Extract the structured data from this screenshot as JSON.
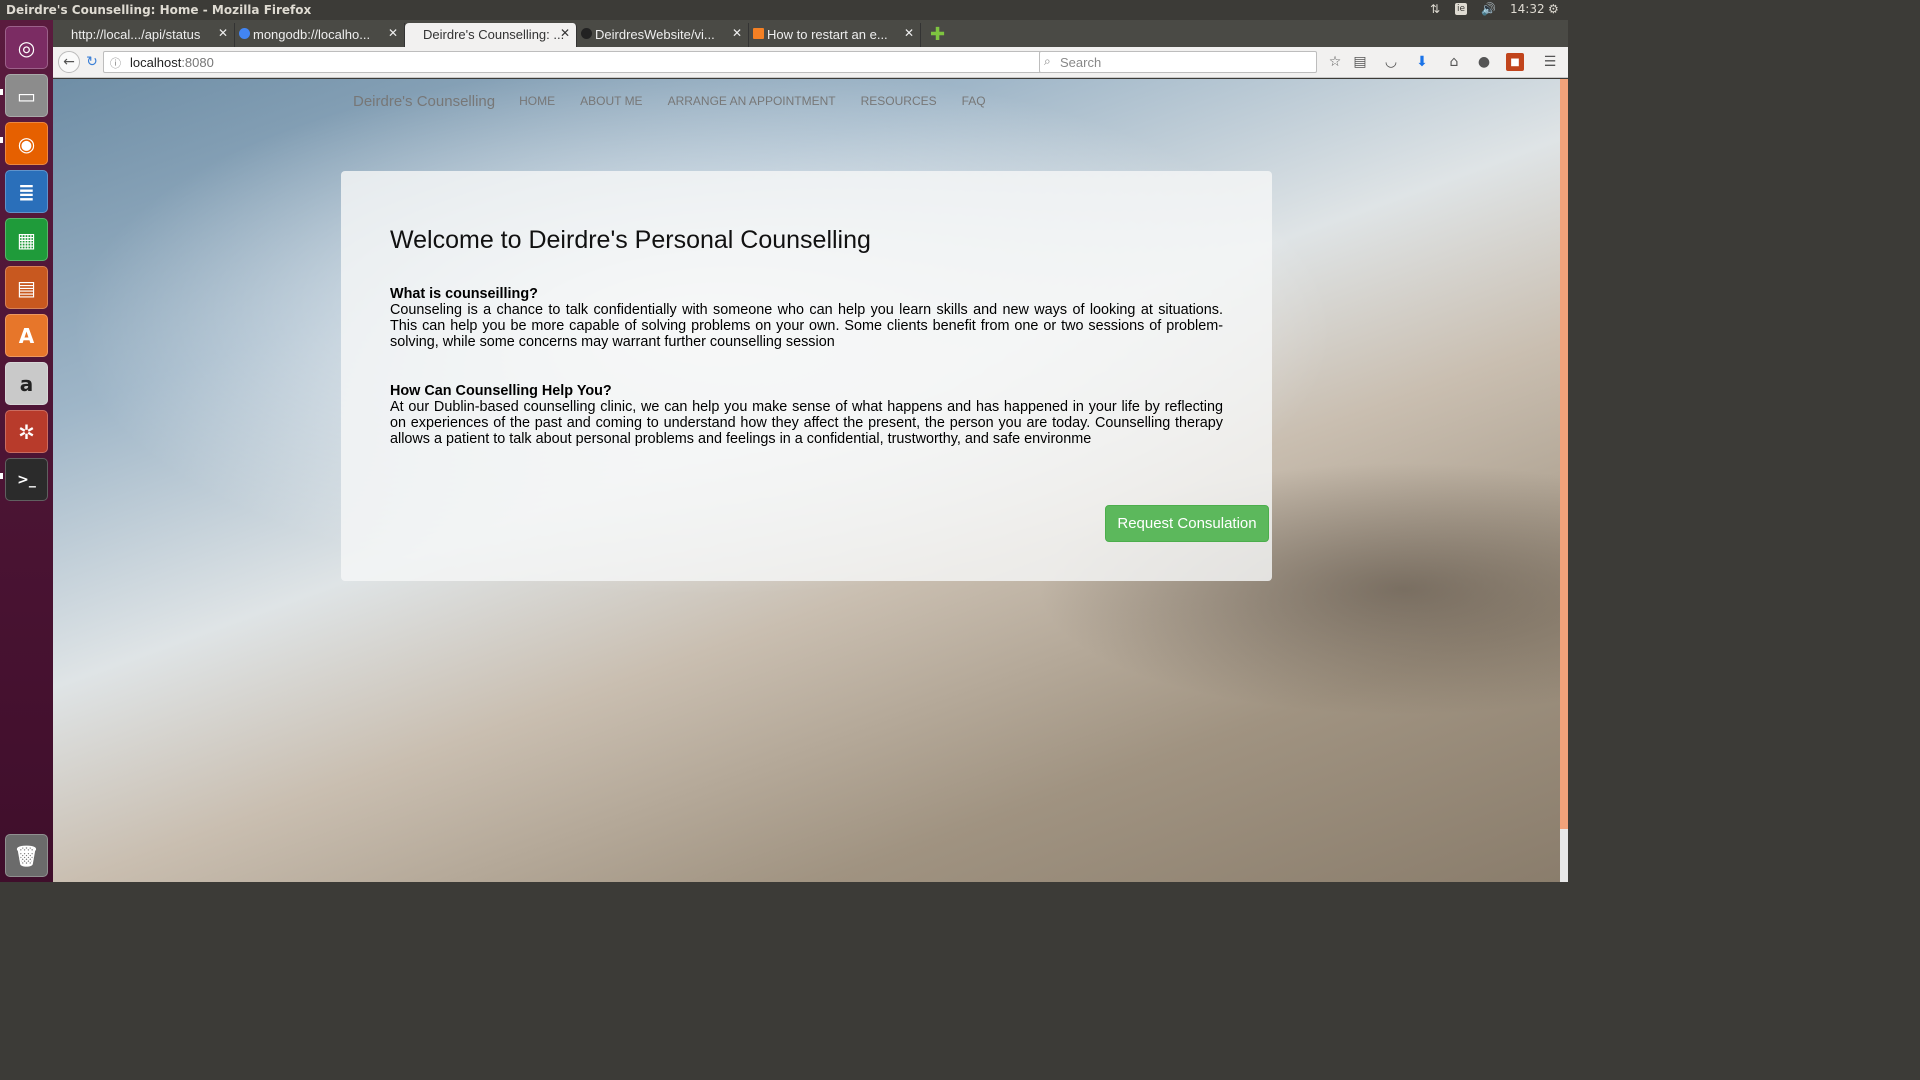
{
  "system": {
    "window_title": "Deirdre's Counselling: Home - Mozilla Firefox",
    "keyboard_layout": "ie",
    "clock": "14:32"
  },
  "launcher": {
    "items": [
      {
        "name": "dash-home",
        "icon": "ubuntu-logo-icon",
        "color": "#7b2c63"
      },
      {
        "name": "files",
        "icon": "file-cabinet-icon",
        "color": "#8c8c8c"
      },
      {
        "name": "firefox",
        "icon": "firefox-icon",
        "color": "#e66000"
      },
      {
        "name": "libreoffice-writer",
        "icon": "writer-document-icon",
        "color": "#2a6fba"
      },
      {
        "name": "libreoffice-calc",
        "icon": "calc-spreadsheet-icon",
        "color": "#1f9b3a"
      },
      {
        "name": "libreoffice-impress",
        "icon": "impress-presentation-icon",
        "color": "#c8581f"
      },
      {
        "name": "software-center",
        "icon": "software-center-bag-icon",
        "color": "#e7762a"
      },
      {
        "name": "amazon",
        "icon": "amazon-icon",
        "color": "#c9c9c9"
      },
      {
        "name": "system-settings",
        "icon": "settings-wrench-icon",
        "color": "#b83b2b"
      },
      {
        "name": "terminal",
        "icon": "terminal-icon",
        "color": "#2b2b2b"
      },
      {
        "name": "trash",
        "icon": "trash-icon",
        "color": "#6b6b6b"
      }
    ]
  },
  "browser": {
    "tabs": [
      {
        "label": "http://local.../api/status",
        "active": false
      },
      {
        "label": "mongodb://localho...",
        "active": false
      },
      {
        "label": "Deirdre's Counselling: ...",
        "active": true
      },
      {
        "label": "DeirdresWebsite/vi...",
        "active": false
      },
      {
        "label": "How to restart an e...",
        "active": false
      }
    ],
    "url_host": "localhost",
    "url_port": ":8080",
    "search_placeholder": "Search"
  },
  "site": {
    "brand": "Deirdre's Counselling",
    "nav": [
      "HOME",
      "ABOUT ME",
      "ARRANGE AN APPOINTMENT",
      "RESOURCES",
      "FAQ"
    ],
    "heading": "Welcome to Deirdre's Personal Counselling",
    "sections": [
      {
        "title": "What is counseilling?",
        "body": "Counseling is a chance to talk confidentially with someone who can help you learn skills and new ways of looking at situations. This can help you be more capable of solving problems on your own. Some clients benefit from one or two sessions of problem-solving, while some concerns may warrant further counselling session"
      },
      {
        "title": "How Can Counselling Help You?",
        "body": "At our Dublin-based counselling clinic, we can help you make sense of what happens and has happened in your life by reflecting on experiences of the past and coming to understand how they affect the present, the person you are today. Counselling therapy allows a patient to talk about personal problems and feelings in a confidential, trustworthy, and safe environme"
      }
    ],
    "cta_label": "Request Consulation",
    "cta_color": "#5cb85c"
  }
}
